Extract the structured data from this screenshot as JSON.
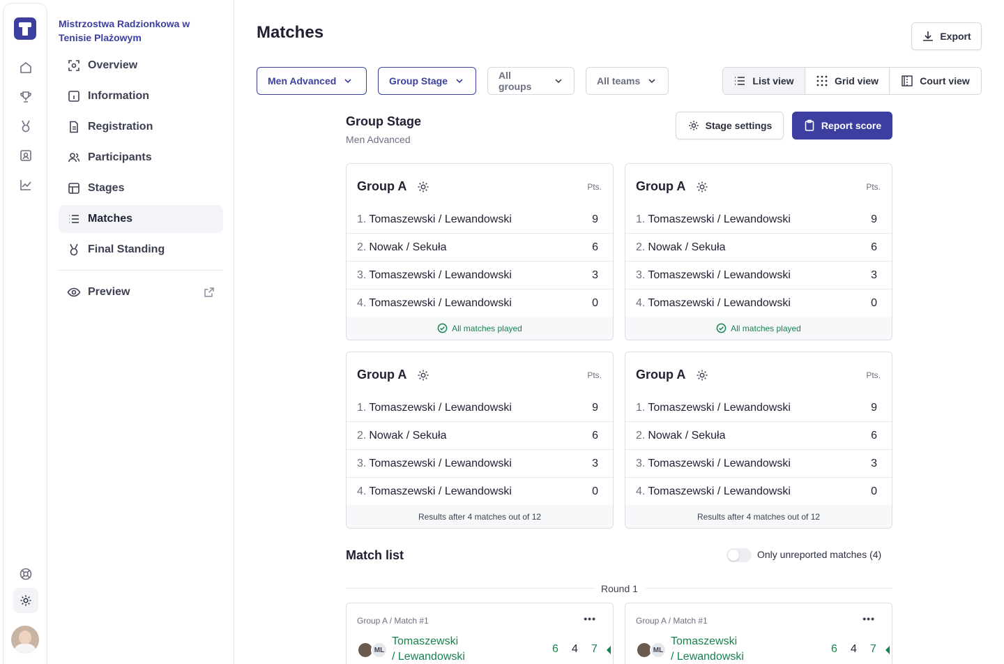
{
  "sidebar": {
    "tournament_name": "Mistrzostwa Radzionkowa w Tenisie Plażowym",
    "items": [
      {
        "label": "Overview",
        "icon": "overview-icon"
      },
      {
        "label": "Information",
        "icon": "info-icon"
      },
      {
        "label": "Registration",
        "icon": "document-icon"
      },
      {
        "label": "Participants",
        "icon": "users-icon"
      },
      {
        "label": "Stages",
        "icon": "table-icon"
      },
      {
        "label": "Matches",
        "icon": "list-icon",
        "active": true
      },
      {
        "label": "Final Standing",
        "icon": "medal-icon"
      }
    ],
    "preview_label": "Preview"
  },
  "header": {
    "title": "Matches",
    "export_label": "Export"
  },
  "filters": {
    "category": "Men Advanced",
    "stage": "Group Stage",
    "groups": "All groups",
    "teams": "All teams"
  },
  "views": {
    "list": "List view",
    "grid": "Grid view",
    "court": "Court view",
    "active": "list"
  },
  "stage": {
    "title": "Group Stage",
    "subtitle": "Men Advanced",
    "settings_label": "Stage settings",
    "report_label": "Report score"
  },
  "groups": [
    {
      "name": "Group A",
      "pts_label": "Pts.",
      "rows": [
        {
          "rank": "1.",
          "team": "Tomaszewski / Lewandowski",
          "pts": "9"
        },
        {
          "rank": "2.",
          "team": "Nowak / Sekuła",
          "pts": "6"
        },
        {
          "rank": "3.",
          "team": "Tomaszewski / Lewandowski",
          "pts": "3"
        },
        {
          "rank": "4.",
          "team": "Tomaszewski / Lewandowski",
          "pts": "0"
        }
      ],
      "footer": "All matches played",
      "footer_ok": true
    },
    {
      "name": "Group A",
      "pts_label": "Pts.",
      "rows": [
        {
          "rank": "1.",
          "team": "Tomaszewski / Lewandowski",
          "pts": "9"
        },
        {
          "rank": "2.",
          "team": "Nowak / Sekuła",
          "pts": "6"
        },
        {
          "rank": "3.",
          "team": "Tomaszewski / Lewandowski",
          "pts": "3"
        },
        {
          "rank": "4.",
          "team": "Tomaszewski / Lewandowski",
          "pts": "0"
        }
      ],
      "footer": "All matches played",
      "footer_ok": true
    },
    {
      "name": "Group A",
      "pts_label": "Pts.",
      "rows": [
        {
          "rank": "1.",
          "team": "Tomaszewski / Lewandowski",
          "pts": "9"
        },
        {
          "rank": "2.",
          "team": "Nowak / Sekuła",
          "pts": "6"
        },
        {
          "rank": "3.",
          "team": "Tomaszewski / Lewandowski",
          "pts": "3"
        },
        {
          "rank": "4.",
          "team": "Tomaszewski / Lewandowski",
          "pts": "0"
        }
      ],
      "footer": "Results after 4 matches out of 12",
      "footer_ok": false
    },
    {
      "name": "Group A",
      "pts_label": "Pts.",
      "rows": [
        {
          "rank": "1.",
          "team": "Tomaszewski / Lewandowski",
          "pts": "9"
        },
        {
          "rank": "2.",
          "team": "Nowak / Sekuła",
          "pts": "6"
        },
        {
          "rank": "3.",
          "team": "Tomaszewski / Lewandowski",
          "pts": "3"
        },
        {
          "rank": "4.",
          "team": "Tomaszewski / Lewandowski",
          "pts": "0"
        }
      ],
      "footer": "Results after 4 matches out of 12",
      "footer_ok": false
    }
  ],
  "match_list": {
    "title": "Match list",
    "toggle_label": "Only unreported matches (4)",
    "round_label": "Round 1",
    "matches": [
      {
        "meta": "Group A / Match #1",
        "initials": "ML",
        "team_line1": "Tomaszewski",
        "team_line2": "/ Lewandowski",
        "scores": [
          "6",
          "4",
          "7"
        ]
      },
      {
        "meta": "Group A / Match #1",
        "initials": "ML",
        "team_line1": "Tomaszewski",
        "team_line2": "/ Lewandowski",
        "scores": [
          "6",
          "4",
          "7"
        ]
      }
    ]
  },
  "colors": {
    "brand": "#3c3fa0",
    "success": "#17824e",
    "border": "#dcdee6"
  }
}
